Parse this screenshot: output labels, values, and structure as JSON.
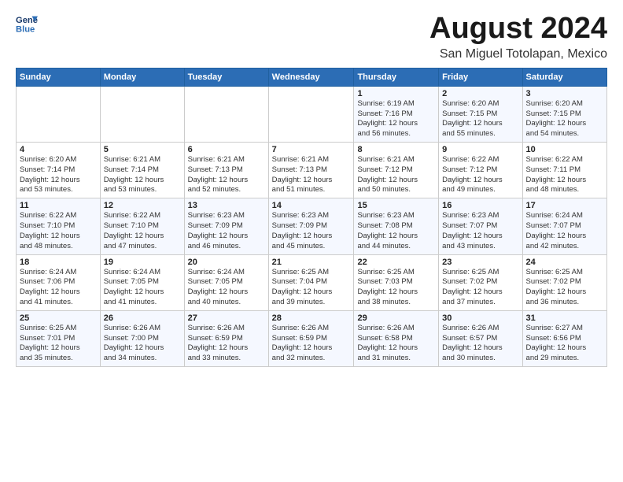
{
  "header": {
    "logo": {
      "line1": "General",
      "line2": "Blue"
    },
    "title": "August 2024",
    "subtitle": "San Miguel Totolapan, Mexico"
  },
  "weekdays": [
    "Sunday",
    "Monday",
    "Tuesday",
    "Wednesday",
    "Thursday",
    "Friday",
    "Saturday"
  ],
  "weeks": [
    [
      {
        "day": "",
        "info": ""
      },
      {
        "day": "",
        "info": ""
      },
      {
        "day": "",
        "info": ""
      },
      {
        "day": "",
        "info": ""
      },
      {
        "day": "1",
        "info": "Sunrise: 6:19 AM\nSunset: 7:16 PM\nDaylight: 12 hours\nand 56 minutes."
      },
      {
        "day": "2",
        "info": "Sunrise: 6:20 AM\nSunset: 7:15 PM\nDaylight: 12 hours\nand 55 minutes."
      },
      {
        "day": "3",
        "info": "Sunrise: 6:20 AM\nSunset: 7:15 PM\nDaylight: 12 hours\nand 54 minutes."
      }
    ],
    [
      {
        "day": "4",
        "info": "Sunrise: 6:20 AM\nSunset: 7:14 PM\nDaylight: 12 hours\nand 53 minutes."
      },
      {
        "day": "5",
        "info": "Sunrise: 6:21 AM\nSunset: 7:14 PM\nDaylight: 12 hours\nand 53 minutes."
      },
      {
        "day": "6",
        "info": "Sunrise: 6:21 AM\nSunset: 7:13 PM\nDaylight: 12 hours\nand 52 minutes."
      },
      {
        "day": "7",
        "info": "Sunrise: 6:21 AM\nSunset: 7:13 PM\nDaylight: 12 hours\nand 51 minutes."
      },
      {
        "day": "8",
        "info": "Sunrise: 6:21 AM\nSunset: 7:12 PM\nDaylight: 12 hours\nand 50 minutes."
      },
      {
        "day": "9",
        "info": "Sunrise: 6:22 AM\nSunset: 7:12 PM\nDaylight: 12 hours\nand 49 minutes."
      },
      {
        "day": "10",
        "info": "Sunrise: 6:22 AM\nSunset: 7:11 PM\nDaylight: 12 hours\nand 48 minutes."
      }
    ],
    [
      {
        "day": "11",
        "info": "Sunrise: 6:22 AM\nSunset: 7:10 PM\nDaylight: 12 hours\nand 48 minutes."
      },
      {
        "day": "12",
        "info": "Sunrise: 6:22 AM\nSunset: 7:10 PM\nDaylight: 12 hours\nand 47 minutes."
      },
      {
        "day": "13",
        "info": "Sunrise: 6:23 AM\nSunset: 7:09 PM\nDaylight: 12 hours\nand 46 minutes."
      },
      {
        "day": "14",
        "info": "Sunrise: 6:23 AM\nSunset: 7:09 PM\nDaylight: 12 hours\nand 45 minutes."
      },
      {
        "day": "15",
        "info": "Sunrise: 6:23 AM\nSunset: 7:08 PM\nDaylight: 12 hours\nand 44 minutes."
      },
      {
        "day": "16",
        "info": "Sunrise: 6:23 AM\nSunset: 7:07 PM\nDaylight: 12 hours\nand 43 minutes."
      },
      {
        "day": "17",
        "info": "Sunrise: 6:24 AM\nSunset: 7:07 PM\nDaylight: 12 hours\nand 42 minutes."
      }
    ],
    [
      {
        "day": "18",
        "info": "Sunrise: 6:24 AM\nSunset: 7:06 PM\nDaylight: 12 hours\nand 41 minutes."
      },
      {
        "day": "19",
        "info": "Sunrise: 6:24 AM\nSunset: 7:05 PM\nDaylight: 12 hours\nand 41 minutes."
      },
      {
        "day": "20",
        "info": "Sunrise: 6:24 AM\nSunset: 7:05 PM\nDaylight: 12 hours\nand 40 minutes."
      },
      {
        "day": "21",
        "info": "Sunrise: 6:25 AM\nSunset: 7:04 PM\nDaylight: 12 hours\nand 39 minutes."
      },
      {
        "day": "22",
        "info": "Sunrise: 6:25 AM\nSunset: 7:03 PM\nDaylight: 12 hours\nand 38 minutes."
      },
      {
        "day": "23",
        "info": "Sunrise: 6:25 AM\nSunset: 7:02 PM\nDaylight: 12 hours\nand 37 minutes."
      },
      {
        "day": "24",
        "info": "Sunrise: 6:25 AM\nSunset: 7:02 PM\nDaylight: 12 hours\nand 36 minutes."
      }
    ],
    [
      {
        "day": "25",
        "info": "Sunrise: 6:25 AM\nSunset: 7:01 PM\nDaylight: 12 hours\nand 35 minutes."
      },
      {
        "day": "26",
        "info": "Sunrise: 6:26 AM\nSunset: 7:00 PM\nDaylight: 12 hours\nand 34 minutes."
      },
      {
        "day": "27",
        "info": "Sunrise: 6:26 AM\nSunset: 6:59 PM\nDaylight: 12 hours\nand 33 minutes."
      },
      {
        "day": "28",
        "info": "Sunrise: 6:26 AM\nSunset: 6:59 PM\nDaylight: 12 hours\nand 32 minutes."
      },
      {
        "day": "29",
        "info": "Sunrise: 6:26 AM\nSunset: 6:58 PM\nDaylight: 12 hours\nand 31 minutes."
      },
      {
        "day": "30",
        "info": "Sunrise: 6:26 AM\nSunset: 6:57 PM\nDaylight: 12 hours\nand 30 minutes."
      },
      {
        "day": "31",
        "info": "Sunrise: 6:27 AM\nSunset: 6:56 PM\nDaylight: 12 hours\nand 29 minutes."
      }
    ]
  ]
}
